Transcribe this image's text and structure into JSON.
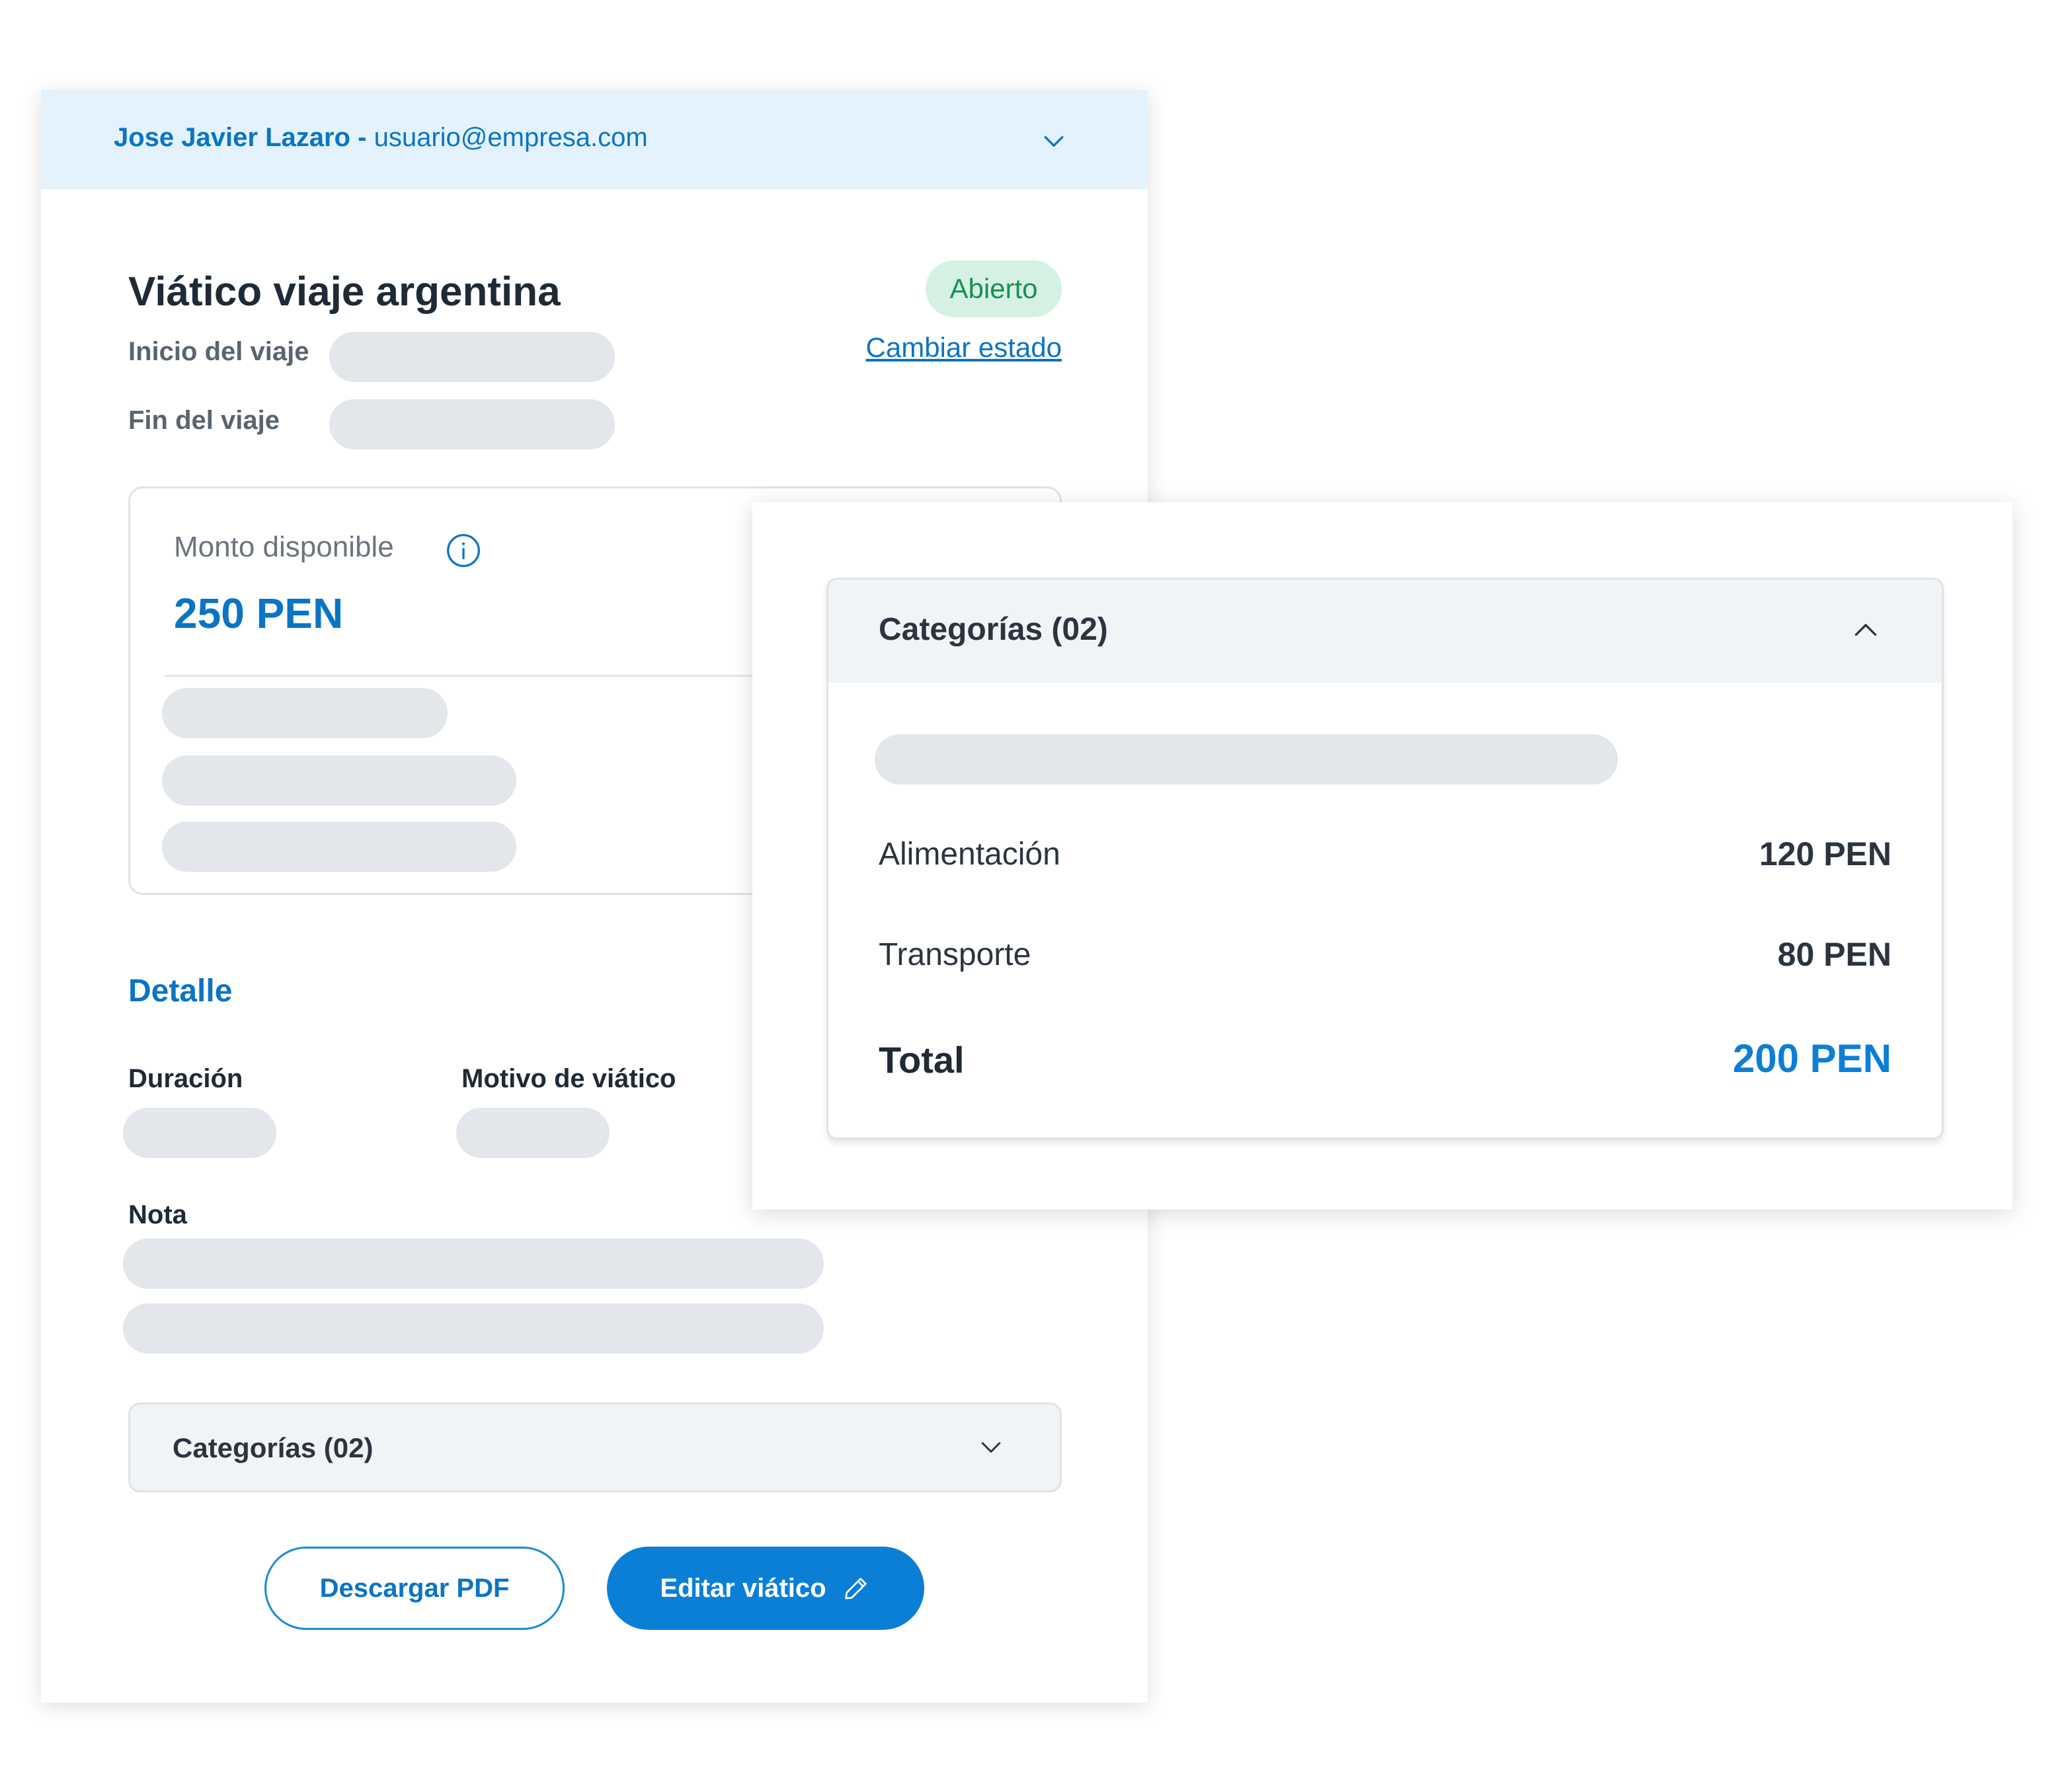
{
  "header": {
    "user_name": "Jose Javier Lazaro",
    "separator": "-",
    "user_email": "usuario@empresa.com"
  },
  "trip": {
    "title": "Viático viaje argentina",
    "status": "Abierto",
    "change_status_label": "Cambiar estado",
    "start_label": "Inicio del viaje",
    "end_label": "Fin del viaje"
  },
  "amount": {
    "label": "Monto disponible",
    "value": "250 PEN"
  },
  "detail": {
    "heading": "Detalle",
    "duration_label": "Duración",
    "reason_label": "Motivo de viático",
    "note_label": "Nota"
  },
  "categories_accordion": {
    "label": "Categorías (02)"
  },
  "actions": {
    "download_label": "Descargar PDF",
    "edit_label": "Editar viático"
  },
  "categories_panel": {
    "title": "Categorías (02)",
    "items": [
      {
        "name": "Alimentación",
        "amount": "120 PEN"
      },
      {
        "name": "Transporte",
        "amount": "80 PEN"
      }
    ],
    "total_label": "Total",
    "total_value": "200 PEN"
  },
  "colors": {
    "primary": "#0b7fd6",
    "header_bg": "#e3f2fc",
    "status_bg": "#d5f1e3",
    "status_text": "#1a8f55",
    "skeleton": "#e3e6ea"
  },
  "icons": {
    "header_chevron": "chevron-down-icon",
    "info": "info-icon",
    "accordion_chevron": "chevron-down-icon",
    "edit": "pencil-icon",
    "panel_chevron": "chevron-up-icon"
  }
}
